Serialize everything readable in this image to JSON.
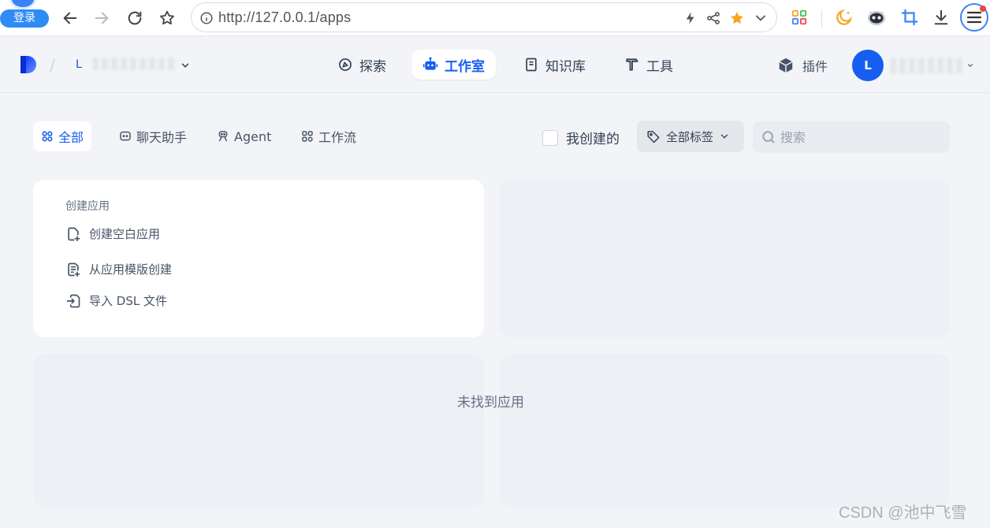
{
  "browser": {
    "login_label": "登录",
    "url": "http://127.0.0.1/apps"
  },
  "header": {
    "workspace_initial": "L",
    "nav": [
      {
        "label": "探索"
      },
      {
        "label": "工作室"
      },
      {
        "label": "知识库"
      },
      {
        "label": "工具"
      }
    ],
    "plugin_label": "插件",
    "user_initial": "L",
    "accent_color": "#155eef"
  },
  "filters": {
    "tabs": [
      {
        "label": "全部"
      },
      {
        "label": "聊天助手"
      },
      {
        "label": "Agent"
      },
      {
        "label": "工作流"
      }
    ],
    "mine_label": "我创建的",
    "tag_select_label": "全部标签",
    "search_placeholder": "搜索"
  },
  "create_card": {
    "title": "创建应用",
    "items": [
      {
        "label": "创建空白应用"
      },
      {
        "label": "从应用模版创建"
      },
      {
        "label": "导入 DSL 文件"
      }
    ]
  },
  "empty_state": "未找到应用",
  "watermark": "CSDN @池中飞雪"
}
